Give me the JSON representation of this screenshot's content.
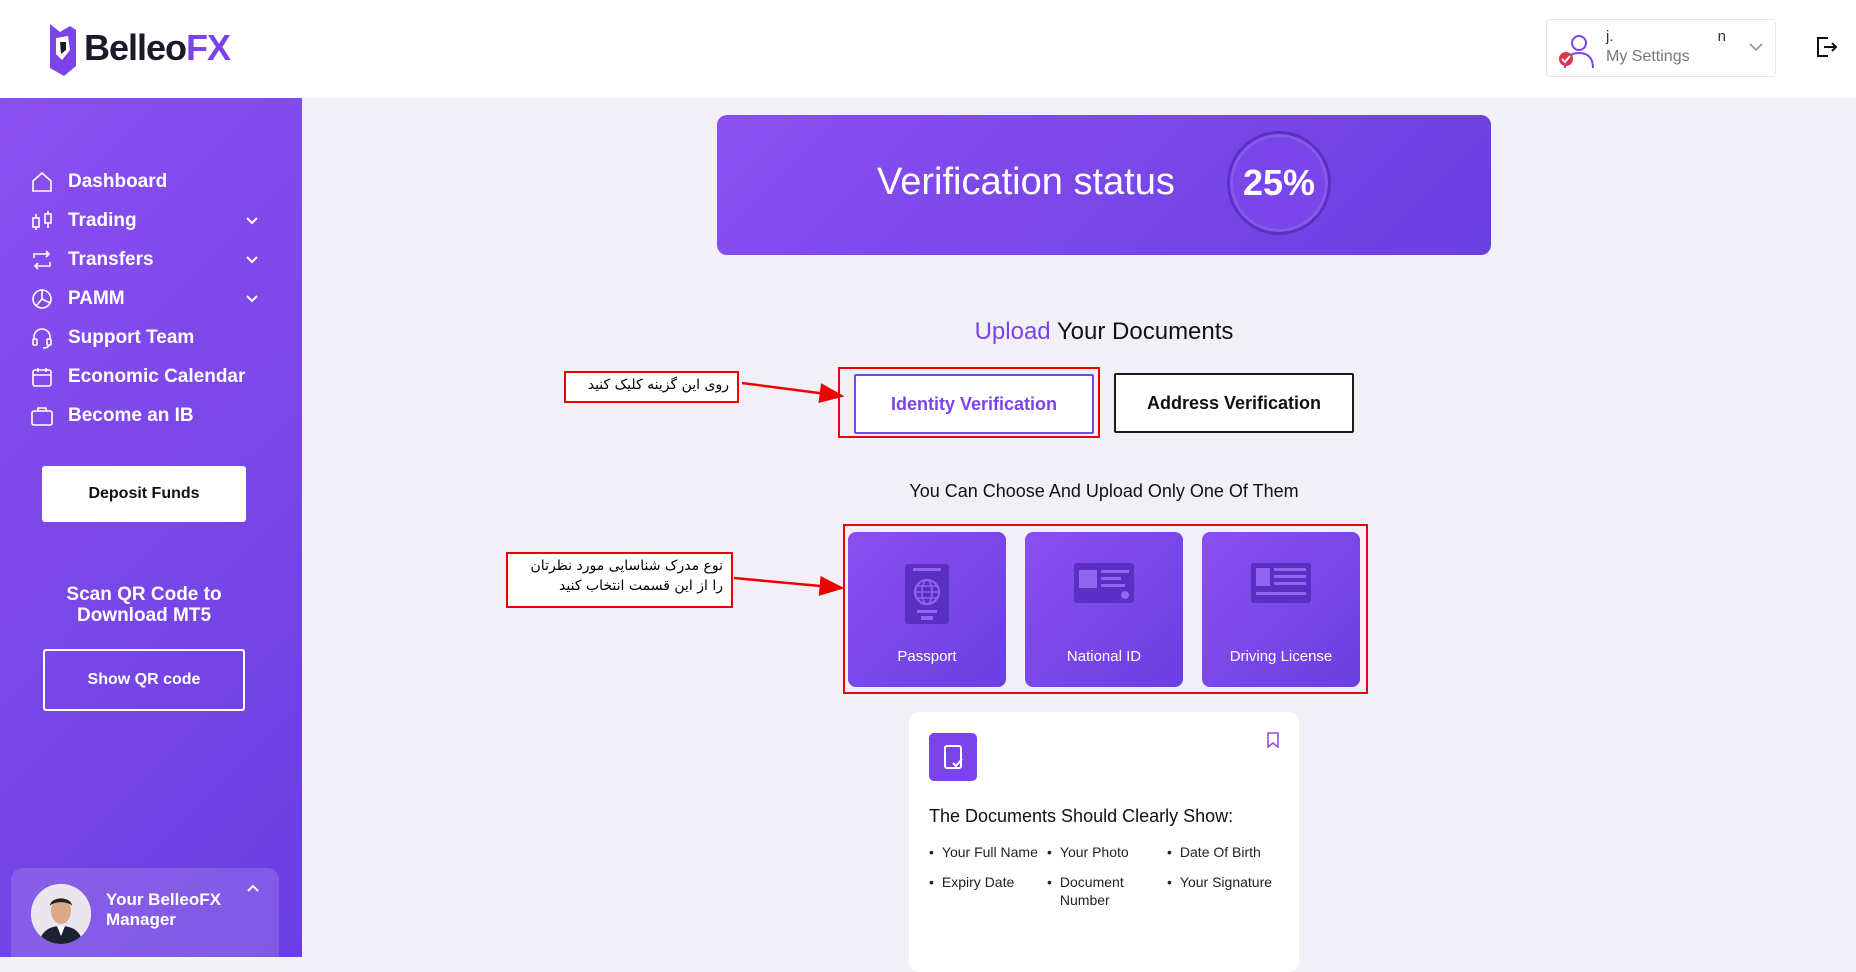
{
  "brand": {
    "name_part1": "Belleo",
    "name_part2": "FX"
  },
  "user": {
    "name_initial": "j.",
    "name_end": "n",
    "settings_label": "My Settings"
  },
  "sidebar": {
    "items": [
      {
        "label": "Dashboard",
        "icon": "home-icon"
      },
      {
        "label": "Trading",
        "icon": "candlestick-icon"
      },
      {
        "label": "Transfers",
        "icon": "transfer-icon"
      },
      {
        "label": "PAMM",
        "icon": "pie-chart-icon"
      },
      {
        "label": "Support Team",
        "icon": "headset-icon"
      },
      {
        "label": "Economic Calendar",
        "icon": "calendar-icon"
      },
      {
        "label": "Become an IB",
        "icon": "briefcase-icon"
      }
    ],
    "deposit_label": "Deposit Funds",
    "qr_text": "Scan QR Code to Download MT5",
    "qr_button": "Show QR code",
    "manager_label": "Your BelleoFX Manager"
  },
  "verification": {
    "title": "Verification status",
    "percent": "25%"
  },
  "upload": {
    "title_highlight": "Upload",
    "title_rest": " Your Documents",
    "tabs": {
      "identity": "Identity Verification",
      "address": "Address Verification"
    },
    "choose_text": "You Can Choose And Upload Only One Of Them",
    "documents": [
      {
        "label": "Passport"
      },
      {
        "label": "National ID"
      },
      {
        "label": "Driving License"
      }
    ]
  },
  "info": {
    "title": "The Documents Should Clearly Show:",
    "items": [
      "Your Full Name",
      "Your Photo",
      "Date Of Birth",
      "Expiry Date",
      "Document Number",
      "Your Signature"
    ]
  },
  "annotations": {
    "note1": "روی این گزینه کلیک کنید",
    "note2_line1": "نوع مدرک شناسایی مورد نظرتان",
    "note2_line2": "را از این قسمت انتخاب کنید"
  },
  "colors": {
    "accent": "#7b44ea",
    "sidebar_start": "#8b4ff0",
    "sidebar_end": "#6a3fe0",
    "annotation": "#e00000"
  }
}
